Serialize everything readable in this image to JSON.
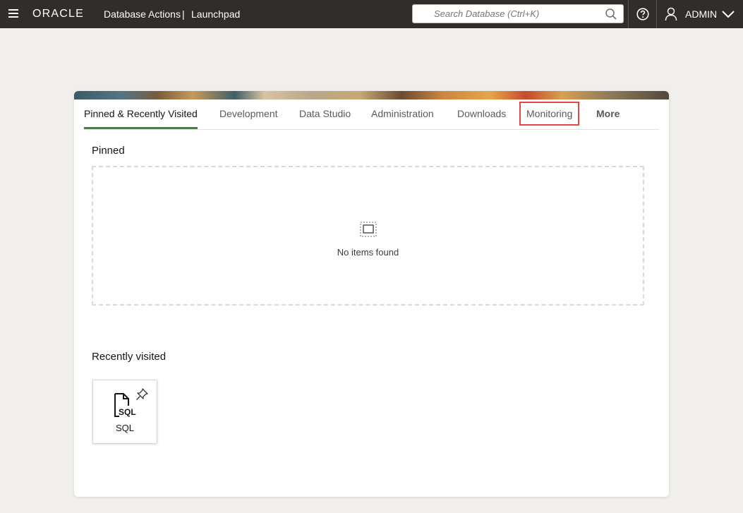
{
  "header": {
    "brand": "ORACLE",
    "app_name": "Database Actions",
    "separator": "|",
    "page_name": "Launchpad",
    "search_placeholder": "Search Database (Ctrl+K)",
    "user_name": "ADMIN"
  },
  "tabs": [
    {
      "label": "Pinned & Recently Visited",
      "active": true
    },
    {
      "label": "Development"
    },
    {
      "label": "Data Studio"
    },
    {
      "label": "Administration"
    },
    {
      "label": "Downloads"
    },
    {
      "label": "Monitoring",
      "highlighted": true
    },
    {
      "label": "More"
    }
  ],
  "pinned": {
    "title": "Pinned",
    "empty_message": "No items found"
  },
  "recent": {
    "title": "Recently visited",
    "items": [
      {
        "label": "SQL",
        "icon": "sql-file-icon",
        "icon_text": "SQL"
      }
    ]
  },
  "colors": {
    "header_bg": "#312d2a",
    "active_tab_underline": "#4f7a4f",
    "highlight_border": "#e0474c"
  }
}
